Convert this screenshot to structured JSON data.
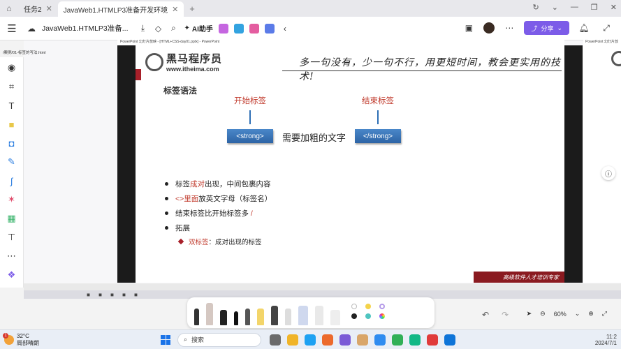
{
  "browser": {
    "tabs": [
      {
        "label": "任务2"
      },
      {
        "label": "JavaWeb1.HTMLP3准备开发环境",
        "active": true
      }
    ]
  },
  "toolbar": {
    "doc_title": "JavaWeb1.HTMLP3准备...",
    "ai_label": "AI助手",
    "share_label": "分享",
    "app_sq_colors": [
      "#c566e0",
      "#33a3e0",
      "#e45da0",
      "#5b7be8"
    ]
  },
  "canvas": {
    "left_subtitle": "/案例/01-标签的写法.html",
    "ppt_titlebar": "PowerPoint 幻灯片放映 - [HTML+CSS-day01.pptx] - PowerPoint",
    "ppt2_titlebar": "PowerPoint 幻灯片放映"
  },
  "slide": {
    "logo_cn": "黑马程序员",
    "logo_url": "www.itheima.com",
    "slogan": "多一句没有，少一句不行，用更短时间，教会更实用的技术!",
    "section_title": "标签语法",
    "open_label": "开始标签",
    "close_label": "结束标签",
    "open_tag": "<strong>",
    "close_tag": "</strong>",
    "middle_text": "需要加粗的文字",
    "bullets": [
      {
        "pre": "标签",
        "red": "成对",
        "post": "出现，中间包裹内容"
      },
      {
        "pre": "",
        "red": "<>里面",
        "post": "放英文字母（标签名）"
      },
      {
        "pre": "结束标签比开始标签多 ",
        "red": "/",
        "post": ""
      },
      {
        "pre": "拓展",
        "red": "",
        "post": ""
      }
    ],
    "sub_bullet_red": "双标签",
    "sub_bullet_text": "：成对出现的标签",
    "banner": "高级软件人才培训专家"
  },
  "controls": {
    "zoom": "60%"
  },
  "taskbar": {
    "temp": "32°C",
    "weather": "局部晴朗",
    "weather_badge": "1",
    "search_placeholder": "搜索",
    "time": "11:2",
    "date": "2024/7/1"
  },
  "colors": {
    "accent": "#7c5ce8",
    "slide_red": "#a8202a",
    "tag_blue": "#2d64a5"
  }
}
